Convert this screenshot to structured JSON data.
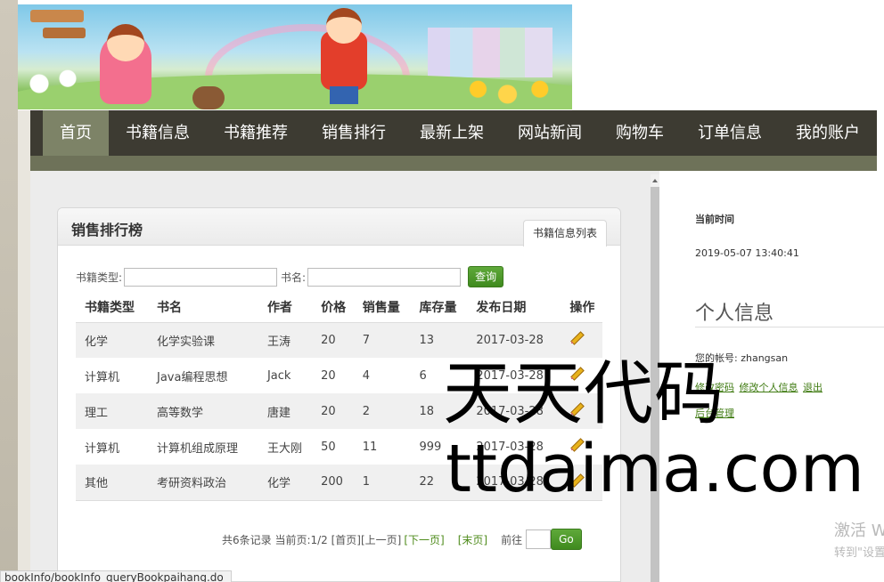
{
  "nav": {
    "items": [
      {
        "label": "首页",
        "active": true
      },
      {
        "label": "书籍信息"
      },
      {
        "label": "书籍推荐"
      },
      {
        "label": "销售排行"
      },
      {
        "label": "最新上架"
      },
      {
        "label": "网站新闻"
      },
      {
        "label": "购物车"
      },
      {
        "label": "订单信息"
      },
      {
        "label": "我的账户"
      }
    ]
  },
  "panel": {
    "title": "销售排行榜",
    "tab_label": "书籍信息列表"
  },
  "search": {
    "type_label": "书籍类型:",
    "type_value": "",
    "name_label": "书名:",
    "name_value": "",
    "query_button": "查询"
  },
  "table": {
    "headers": [
      "书籍类型",
      "书名",
      "作者",
      "价格",
      "销售量",
      "库存量",
      "发布日期",
      "操作"
    ],
    "rows": [
      {
        "type": "化学",
        "name": "化学实验课",
        "author": "王涛",
        "price": "20",
        "sales": "7",
        "stock": "13",
        "date": "2017-03-28"
      },
      {
        "type": "计算机",
        "name": "Java编程思想",
        "author": "Jack",
        "price": "20",
        "sales": "4",
        "stock": "6",
        "date": "2017-03-28"
      },
      {
        "type": "理工",
        "name": "高等数学",
        "author": "唐建",
        "price": "20",
        "sales": "2",
        "stock": "18",
        "date": "2017-03-28"
      },
      {
        "type": "计算机",
        "name": "计算机组成原理",
        "author": "王大刚",
        "price": "50",
        "sales": "11",
        "stock": "999",
        "date": "2017-03-28"
      },
      {
        "type": "其他",
        "name": "考研资料政治",
        "author": "化学",
        "price": "200",
        "sales": "1",
        "stock": "22",
        "date": "2017-03-28"
      }
    ]
  },
  "pager": {
    "summary": "共6条记录 当前页:1/2 [首页][上一页]",
    "next": "[下一页]",
    "last": "[末页]",
    "goto_label": "前往",
    "goto_value": "",
    "go_button": "Go"
  },
  "sidebar": {
    "time_label": "当前时间",
    "time_value": "2019-05-07 13:40:41",
    "section_title": "个人信息",
    "account_text": "您的帐号: zhangsan",
    "links": [
      "修改密码",
      "修改个人信息",
      "退出"
    ],
    "admin_link": "后台管理"
  },
  "windows_activation": {
    "line1": "激活 W",
    "line2": "转到\"设置"
  },
  "status_url": "bookInfo/bookInfo_queryBookpaihang.do",
  "watermark": {
    "line1": "天天代码",
    "line2": "ttdaima.com"
  },
  "colors": {
    "nav_bg": "#3d3b32",
    "nav_active": "#7d8367",
    "link_green": "#4f8c1c",
    "button_green": "#4a9a28"
  },
  "icons": {
    "edit": "pencil-icon"
  }
}
